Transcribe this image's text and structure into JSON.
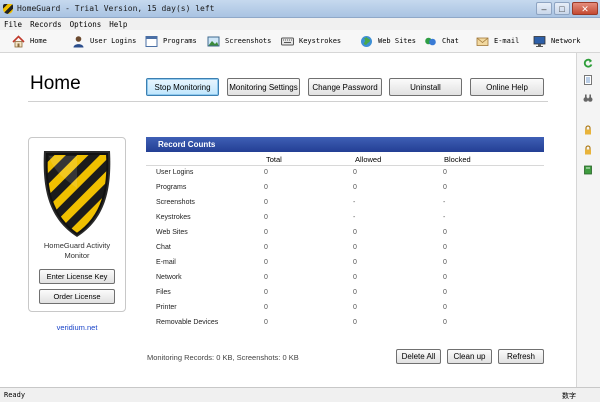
{
  "window": {
    "title": "HomeGuard - Trial Version, 15 day(s) left"
  },
  "menu": [
    "File",
    "Records",
    "Options",
    "Help"
  ],
  "toolbar": [
    {
      "label": "Home",
      "icon": "house-icon"
    },
    {
      "label": "User Logins",
      "icon": "user-icon"
    },
    {
      "label": "Programs",
      "icon": "window-icon"
    },
    {
      "label": "Screenshots",
      "icon": "picture-icon"
    },
    {
      "label": "Keystrokes",
      "icon": "keyboard-icon"
    },
    {
      "label": "Web Sites",
      "icon": "globe-icon"
    },
    {
      "label": "Chat",
      "icon": "chat-icon"
    },
    {
      "label": "E-mail",
      "icon": "envelope-icon"
    },
    {
      "label": "Network",
      "icon": "monitor-icon"
    }
  ],
  "page": {
    "title": "Home"
  },
  "actions": {
    "stop_monitoring": "Stop Monitoring",
    "monitoring_settings": "Monitoring Settings",
    "change_password": "Change Password",
    "uninstall": "Uninstall",
    "online_help": "Online Help"
  },
  "license": {
    "product_line1": "HomeGuard Activity",
    "product_line2": "Monitor",
    "enter_key": "Enter License Key",
    "order": "Order License",
    "vendor": "veridium.net"
  },
  "records": {
    "title": "Record Counts",
    "columns": [
      "",
      "Total",
      "Allowed",
      "Blocked"
    ],
    "rows": [
      {
        "name": "User Logins",
        "total": "0",
        "allowed": "0",
        "blocked": "0"
      },
      {
        "name": "Programs",
        "total": "0",
        "allowed": "0",
        "blocked": "0"
      },
      {
        "name": "Screenshots",
        "total": "0",
        "allowed": "-",
        "blocked": "-"
      },
      {
        "name": "Keystrokes",
        "total": "0",
        "allowed": "-",
        "blocked": "-"
      },
      {
        "name": "Web Sites",
        "total": "0",
        "allowed": "0",
        "blocked": "0"
      },
      {
        "name": "Chat",
        "total": "0",
        "allowed": "0",
        "blocked": "0"
      },
      {
        "name": "E-mail",
        "total": "0",
        "allowed": "0",
        "blocked": "0"
      },
      {
        "name": "Network",
        "total": "0",
        "allowed": "0",
        "blocked": "0"
      },
      {
        "name": "Files",
        "total": "0",
        "allowed": "0",
        "blocked": "0"
      },
      {
        "name": "Printer",
        "total": "0",
        "allowed": "0",
        "blocked": "0"
      },
      {
        "name": "Removable Devices",
        "total": "0",
        "allowed": "0",
        "blocked": "0"
      }
    ]
  },
  "footer": {
    "summary": "Monitoring Records: 0 KB, Screenshots: 0 KB",
    "delete_all": "Delete All",
    "clean_up": "Clean up",
    "refresh": "Refresh"
  },
  "status": {
    "left": "Ready",
    "right": "数字"
  },
  "colors": {
    "header_blue": "#2d4aa1",
    "link_blue": "#1a44c8",
    "shield_yellow": "#f0c000"
  }
}
